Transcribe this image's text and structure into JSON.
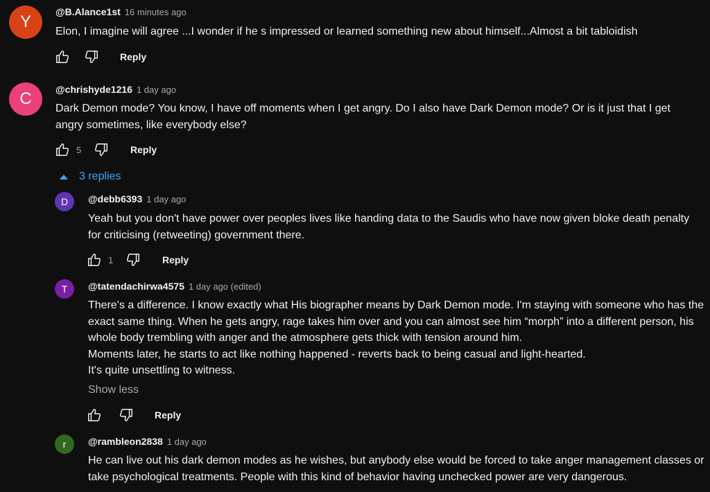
{
  "comments": [
    {
      "avatar_letter": "Y",
      "avatar_color": "#d84315",
      "handle": "@B.Alance1st",
      "time": "16 minutes ago",
      "text": "Elon, I imagine will agree ...I wonder if he s impressed or learned something new about himself...Almost a bit tabloidish",
      "likes": "",
      "reply_label": "Reply"
    },
    {
      "avatar_letter": "C",
      "avatar_color": "#ec407a",
      "handle": "@chrishyde1216",
      "time": "1 day ago",
      "text": "Dark Demon mode?  You know, I have off moments when I get angry.  Do I also have Dark Demon mode?  Or is it just that I get angry sometimes, like everybody else?",
      "likes": "5",
      "reply_label": "Reply",
      "replies_toggle": "3 replies"
    }
  ],
  "replies": [
    {
      "avatar_letter": "D",
      "avatar_color": "#5e35b1",
      "handle": "@debb6393",
      "time": "1 day ago",
      "text": "Yeah but you don't have power over peoples lives like handing data to the Saudis who have now given bloke death penalty for criticising (retweeting) government there.",
      "likes": "1",
      "reply_label": "Reply"
    },
    {
      "avatar_letter": "T",
      "avatar_color": "#7b1fa2",
      "handle": "@tatendachirwa4575",
      "time": "1 day ago (edited)",
      "text": "There's a difference. I know exactly what His biographer means by Dark Demon mode. I'm staying with someone who has the exact same thing. When he gets angry, rage takes him over and you can almost see him “morph” into a different person, his whole body trembling with anger and the atmosphere gets thick with tension around him.\nMoments later, he starts to act like nothing happened - reverts back to being casual and light-hearted.\nIt's quite unsettling to witness.",
      "show_less": "Show less",
      "likes": "",
      "reply_label": "Reply"
    },
    {
      "avatar_letter": "r",
      "avatar_color": "#33691e",
      "handle": "@rambleon2838",
      "time": "1 day ago",
      "text": "He can live out his dark demon modes as he wishes, but anybody else would be forced to take anger management classes or take psychological treatments. People with this kind of behavior having unchecked power are very dangerous.",
      "likes": "",
      "reply_label": "Reply"
    }
  ],
  "icons": {
    "like": "thumbs-up-icon",
    "dislike": "thumbs-down-icon",
    "toggle": "caret-up-icon"
  }
}
